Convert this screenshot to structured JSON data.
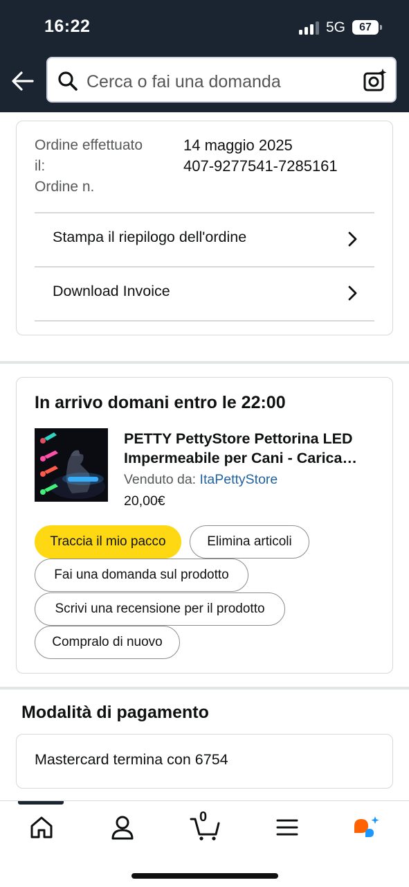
{
  "status_bar": {
    "time": "16:22",
    "network": "5G",
    "battery": "67"
  },
  "search": {
    "placeholder": "Cerca o fai una domanda"
  },
  "order": {
    "date_label_line1": "Ordine effettuato",
    "date_label_line2": "il:",
    "number_label": "Ordine n.",
    "date_value": "14 maggio 2025",
    "number_value": "407-9277541-7285161",
    "actions": [
      {
        "label": "Stampa il riepilogo dell'ordine"
      },
      {
        "label": "Download Invoice"
      }
    ]
  },
  "shipment": {
    "heading": "In arrivo domani entro le 22:00",
    "product": {
      "title_line1": "PETTY PettyStore Pettorina LED",
      "title_line2": "Impermeabile per Cani - Carica…",
      "sold_by_label": "Venduto da:",
      "seller": "ItaPettyStore",
      "price": "20,00€"
    },
    "buttons": {
      "track": "Traccia il mio pacco",
      "delete": "Elimina articoli",
      "ask": "Fai una domanda sul prodotto",
      "review": "Scrivi una recensione per il prodotto",
      "rebuy": "Compralo di nuovo"
    }
  },
  "payment": {
    "heading": "Modalità di pagamento",
    "card_text": "Mastercard termina con 6754"
  },
  "bottom_nav": {
    "cart_count": "0"
  },
  "colors": {
    "header": "#1b2532",
    "primary_button": "#ffd814",
    "link": "#2162a1",
    "rufus_orange": "#ff6200",
    "rufus_blue": "#1a98ff"
  }
}
